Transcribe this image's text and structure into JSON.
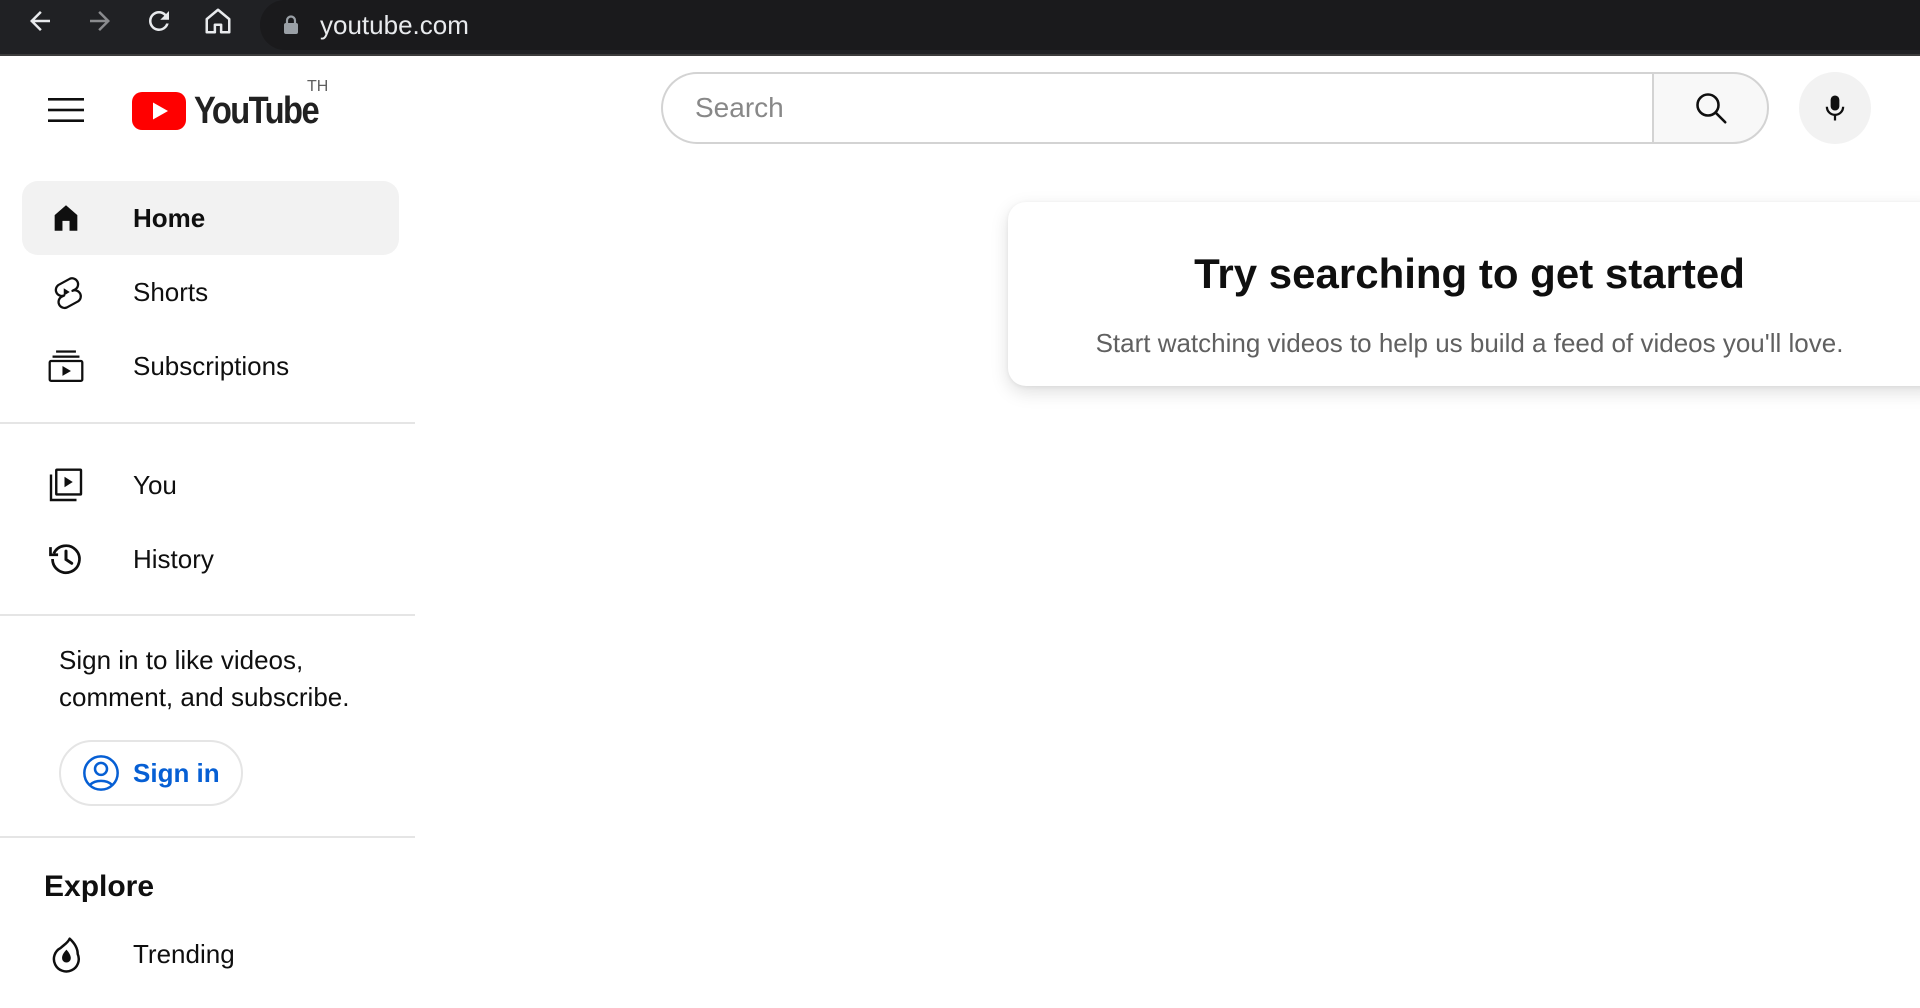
{
  "browser": {
    "url": "youtube.com",
    "icons": [
      "back-icon",
      "forward-icon",
      "reload-icon",
      "home-icon",
      "lock-icon"
    ]
  },
  "masthead": {
    "logo_text": "YouTube",
    "country_code": "TH",
    "search_placeholder": "Search",
    "search_value": "",
    "icons": [
      "menu-icon",
      "search-icon",
      "mic-icon"
    ]
  },
  "sidebar": {
    "primary": [
      {
        "label": "Home",
        "icon": "home-icon",
        "active": true
      },
      {
        "label": "Shorts",
        "icon": "shorts-icon",
        "active": false
      },
      {
        "label": "Subscriptions",
        "icon": "subscriptions-icon",
        "active": false
      }
    ],
    "secondary": [
      {
        "label": "You",
        "icon": "you-icon"
      },
      {
        "label": "History",
        "icon": "history-icon"
      }
    ],
    "signin_prompt": "Sign in to like videos, comment, and subscribe.",
    "signin_label": "Sign in",
    "explore_title": "Explore",
    "explore": [
      {
        "label": "Trending",
        "icon": "trending-icon"
      }
    ]
  },
  "main": {
    "prompt_title": "Try searching to get started",
    "prompt_subtitle": "Start watching videos to help us build a feed of videos you'll love."
  },
  "colors": {
    "brand_red": "#ff0000",
    "link_blue": "#065fd4",
    "browser_bar": "#202124"
  }
}
